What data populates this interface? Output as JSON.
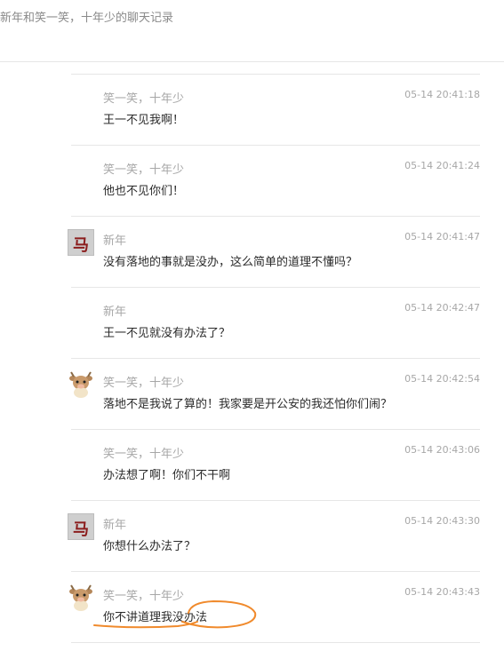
{
  "header": {
    "title": "新年和笑一笑，十年少的聊天记录"
  },
  "colors": {
    "annotation": "#f08a2c",
    "avatar_red": "#8b1d1d"
  },
  "messages": [
    {
      "sender": "笑一笑，十年少",
      "time": "05-14 20:41:18",
      "content": "王一不见我啊！",
      "avatar": "none"
    },
    {
      "sender": "笑一笑，十年少",
      "time": "05-14 20:41:24",
      "content": "他也不见你们！",
      "avatar": "none"
    },
    {
      "sender": "新年",
      "time": "05-14 20:41:47",
      "content": "没有落地的事就是没办，这么简单的道理不懂吗？",
      "avatar": "xinnian-avatar"
    },
    {
      "sender": "新年",
      "time": "05-14 20:42:47",
      "content": "王一不见就没有办法了？",
      "avatar": "none"
    },
    {
      "sender": "笑一笑，十年少",
      "time": "05-14 20:42:54",
      "content": "落地不是我说了算的！我家要是开公安的我还怕你们闹？",
      "avatar": "cow-avatar"
    },
    {
      "sender": "笑一笑，十年少",
      "time": "05-14 20:43:06",
      "content": "办法想了啊！你们不干啊",
      "avatar": "none"
    },
    {
      "sender": "新年",
      "time": "05-14 20:43:30",
      "content": "你想什么办法了？",
      "avatar": "xinnian-avatar"
    },
    {
      "sender": "笑一笑，十年少",
      "time": "05-14 20:43:43",
      "content": "你不讲道理我没办法",
      "avatar": "cow-avatar"
    }
  ]
}
